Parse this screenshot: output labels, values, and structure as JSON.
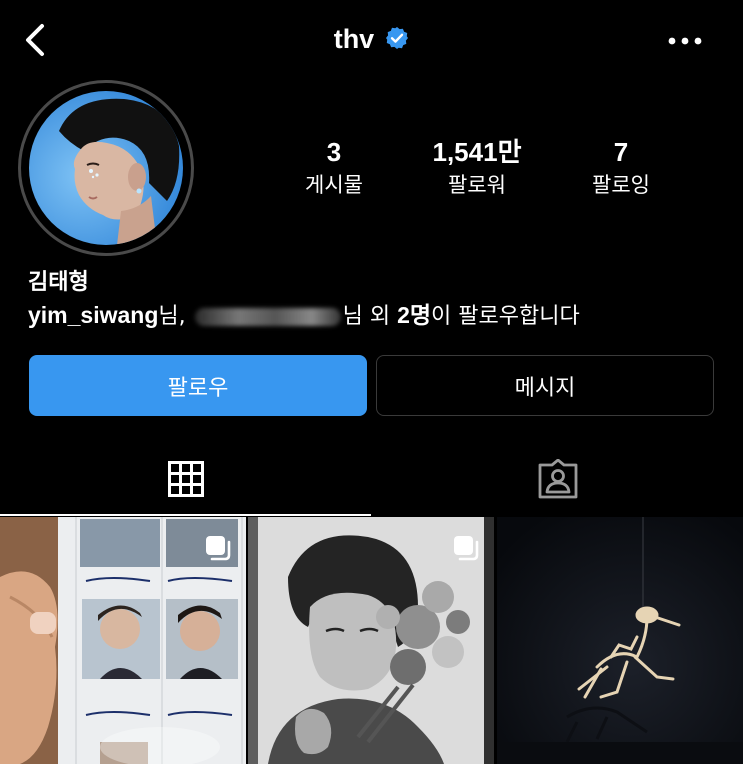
{
  "header": {
    "username": "thv",
    "verified": true,
    "back_icon": "chevron-left-icon",
    "more_icon": "more-horizontal-icon"
  },
  "profile": {
    "name": "김태형",
    "followed_by": {
      "first": "yim_siwang",
      "suffix1": "님,",
      "suffix2": "님 외 ",
      "count": "2명",
      "suffix3": "이 팔로우합니다"
    }
  },
  "stats": [
    {
      "value": "3",
      "label": "게시물"
    },
    {
      "value": "1,541만",
      "label": "팔로워"
    },
    {
      "value": "7",
      "label": "팔로잉"
    }
  ],
  "actions": {
    "follow_label": "팔로우",
    "message_label": "메시지"
  },
  "tabs": [
    {
      "icon": "grid-icon",
      "active": true
    },
    {
      "icon": "tagged-person-icon",
      "active": false
    }
  ],
  "posts": [
    {
      "type": "multi",
      "icon": "multiple-posts-icon"
    },
    {
      "type": "multi",
      "icon": "multiple-posts-icon"
    },
    {
      "type": "single"
    }
  ],
  "colors": {
    "background": "#000000",
    "follow_button": "#3897f0",
    "verified_badge": "#3897f0"
  }
}
